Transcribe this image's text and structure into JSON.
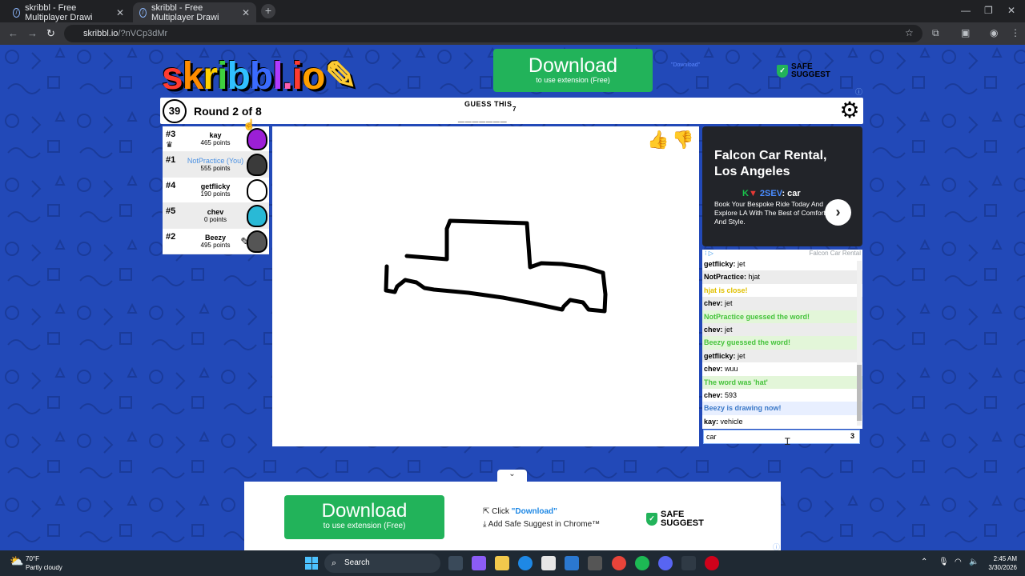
{
  "browser": {
    "tabs": [
      {
        "title": "skribbl - Free Multiplayer Drawi"
      },
      {
        "title": "skribbl - Free Multiplayer Drawi"
      }
    ],
    "url_host": "skribbl.io",
    "url_path": "/?nVCp3dMr"
  },
  "top_ad": {
    "download_label": "Download",
    "download_sub": "to use extension (Free)",
    "line1": "\"Download\"",
    "safe_suggest_line1": "SAFE",
    "safe_suggest_line2": "SUGGEST"
  },
  "logo": {
    "text": "skribbl.io"
  },
  "game": {
    "timer": "39",
    "round_text": "Round 2 of 8",
    "guess_label": "GUESS THIS",
    "word_hint": "_______",
    "word_length": "7"
  },
  "players": [
    {
      "rank": "#3",
      "name": "kay",
      "points": "465 points",
      "color": "#9b1fd6"
    },
    {
      "rank": "#1",
      "name": "NotPractice (You)",
      "points": "555 points",
      "color": "#3a3a3a"
    },
    {
      "rank": "#4",
      "name": "getflicky",
      "points": "190 points",
      "color": "#ffffff"
    },
    {
      "rank": "#5",
      "name": "chev",
      "points": "0 points",
      "color": "#29b9d6"
    },
    {
      "rank": "#2",
      "name": "Beezy",
      "points": "495 points",
      "color": "#555555"
    }
  ],
  "right_ad": {
    "title_line1": "Falcon Car Rental,",
    "title_line2": "Los Angeles",
    "brand_k": "K",
    "brand_r": "▼",
    "brand_mid": "2SEV",
    "brand_rest": ": car",
    "desc": "Book Your Bespoke Ride Today And Explore LA With The Best of Comfort And Style.",
    "footer_name": "Falcon Car Rental"
  },
  "chat": {
    "messages": [
      {
        "user": "getflicky:",
        "text": " jet",
        "type": "normal"
      },
      {
        "user": "NotPractice:",
        "text": " hjat",
        "type": "normal"
      },
      {
        "user": "",
        "text": "hjat is close!",
        "type": "close"
      },
      {
        "user": "chev:",
        "text": " jet",
        "type": "normal"
      },
      {
        "user": "",
        "text": "NotPractice guessed the word!",
        "type": "correct"
      },
      {
        "user": "chev:",
        "text": " jet",
        "type": "normal"
      },
      {
        "user": "",
        "text": "Beezy guessed the word!",
        "type": "correct"
      },
      {
        "user": "getflicky:",
        "text": " jet",
        "type": "normal"
      },
      {
        "user": "chev:",
        "text": " wuu",
        "type": "normal"
      },
      {
        "user": "",
        "text": "The word was 'hat'",
        "type": "correct"
      },
      {
        "user": "chev:",
        "text": " 593",
        "type": "normal"
      },
      {
        "user": "",
        "text": "Beezy is drawing now!",
        "type": "blue"
      },
      {
        "user": "kay:",
        "text": " vehicle",
        "type": "normal"
      }
    ],
    "input_value": "car",
    "char_count": "3"
  },
  "bottom_ad": {
    "download_label": "Download",
    "download_sub": "to use extension (Free)",
    "step1_prefix": "Click ",
    "step1_link": "\"Download\"",
    "step2": "Add Safe Suggest in Chrome™",
    "safe_line1": "SAFE",
    "safe_line2": "SUGGEST"
  },
  "taskbar": {
    "temp": "70°F",
    "condition": "Partly cloudy",
    "search_label": "Search",
    "time": "2:45 AM",
    "date": "3/30/2026"
  },
  "colors": {
    "page_bg": "#2249b8",
    "download_green": "#22b35a"
  }
}
